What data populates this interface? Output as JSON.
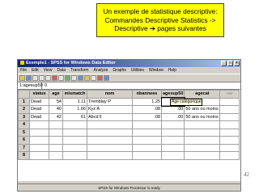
{
  "callout": {
    "line1": "Un exemple de statistique descriptive:",
    "line2": "Commandes Descriptive Statistics ->",
    "line3": "Descriptive ➔ pages suivantes"
  },
  "window": {
    "title": "Exemple1 - SPSS for Windows Data Editor",
    "controls": [
      "_",
      "□",
      "×"
    ]
  },
  "menu": [
    "File",
    "Edit",
    "View",
    "Data",
    "Transform",
    "Analyze",
    "Graphs",
    "Utilities",
    "Window",
    "Help"
  ],
  "cell_editor": {
    "ref": "1:agesup50",
    "value": "0"
  },
  "table": {
    "columns": [
      "status",
      "age",
      "mismatch",
      "nom",
      "nbannees",
      "agesup50",
      "agecat",
      "var"
    ],
    "rows": [
      {
        "num": "1",
        "status": "Dead",
        "age": "54",
        "mismatch": "1.11",
        "nom": "Tremblay P",
        "nbannees": "1.25",
        "agesup50": "1.00",
        "agecat": "",
        "var": ""
      },
      {
        "num": "2",
        "status": "Dead",
        "age": "40",
        "mismatch": "1.66",
        "nom": "Kyz A",
        "nbannees": ".08",
        "agesup50": ".00",
        "agecat": "50 ans ou moins",
        "var": ""
      },
      {
        "num": "3",
        "status": "Dead",
        "age": "42",
        "mismatch": "61",
        "nom": "Abcd ll",
        "nbannees": ".08",
        "agesup50": ".00",
        "agecat": "50 ans ou moins",
        "var": ""
      },
      {
        "num": "4",
        "status": "",
        "age": "",
        "mismatch": "",
        "nom": "",
        "nbannees": "",
        "agesup50": "",
        "agecat": "",
        "var": ""
      },
      {
        "num": "5",
        "status": "",
        "age": "",
        "mismatch": "",
        "nom": "",
        "nbannees": "",
        "agesup50": "",
        "agecat": "",
        "var": ""
      },
      {
        "num": "6",
        "status": "",
        "age": "",
        "mismatch": "",
        "nom": "",
        "nbannees": "",
        "agesup50": "",
        "agecat": "",
        "var": ""
      },
      {
        "num": "7",
        "status": "",
        "age": "",
        "mismatch": "",
        "nom": "",
        "nbannees": "",
        "agesup50": "",
        "agecat": "",
        "var": ""
      },
      {
        "num": "8",
        "status": "",
        "age": "",
        "mismatch": "",
        "nom": "",
        "nbannees": "",
        "agesup50": "",
        "agecat": "",
        "var": ""
      }
    ]
  },
  "tooltip": "Age catégorique",
  "status_bar": "SPSS for Windows Processor is ready",
  "page_number": "42",
  "colors": {
    "callout_bg": "#ffff00",
    "titlebar_start": "#0a246a",
    "titlebar_end": "#a6caf0",
    "window_face": "#d4d0c8"
  },
  "toolbar_icons": [
    "open-icon",
    "save-icon",
    "print-icon",
    "undo-icon",
    "redo-icon",
    "goto-chart-icon",
    "find-icon",
    "insert-case-icon",
    "insert-variable-icon",
    "split-file-icon",
    "weight-cases-icon",
    "select-cases-icon",
    "value-labels-icon",
    "use-sets-icon"
  ]
}
